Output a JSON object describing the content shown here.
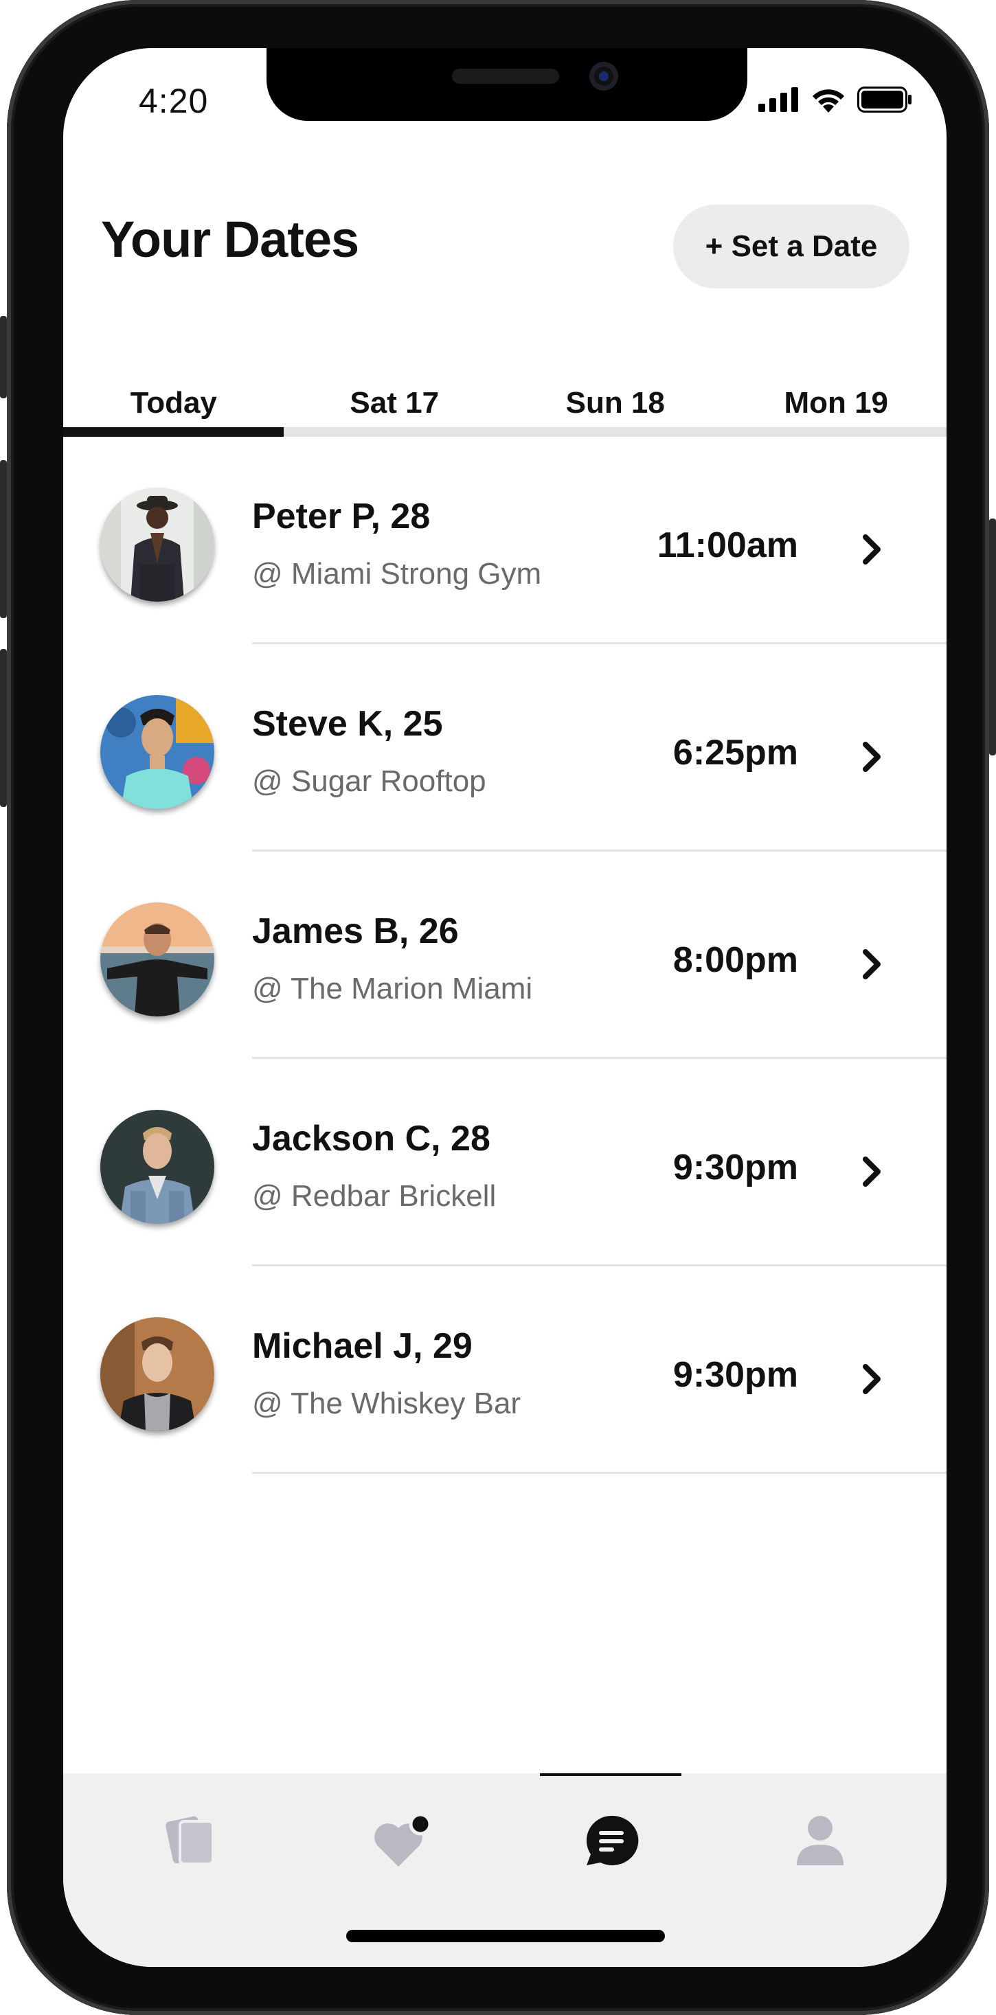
{
  "status_bar": {
    "time": "4:20"
  },
  "header": {
    "title": "Your Dates",
    "set_date_label": "+ Set a Date"
  },
  "tabs": [
    {
      "label": "Today"
    },
    {
      "label": "Sat 17"
    },
    {
      "label": "Sun 18"
    },
    {
      "label": "Mon 19"
    }
  ],
  "dates": [
    {
      "name": "Peter P, 28",
      "venue": "@ Miami Strong Gym",
      "time": "11:00am"
    },
    {
      "name": "Steve K, 25",
      "venue": "@ Sugar Rooftop",
      "time": "6:25pm"
    },
    {
      "name": "James B, 26",
      "venue": "@ The Marion Miami",
      "time": "8:00pm"
    },
    {
      "name": "Jackson C, 28",
      "venue": "@ Redbar Brickell",
      "time": "9:30pm"
    },
    {
      "name": "Michael J, 29",
      "venue": "@ The Whiskey Bar",
      "time": "9:30pm"
    }
  ],
  "bottom_nav": [
    {
      "icon": "cards-icon",
      "active": false
    },
    {
      "icon": "heart-notification-icon",
      "active": false
    },
    {
      "icon": "chat-bubble-icon",
      "active": true
    },
    {
      "icon": "profile-icon",
      "active": false
    }
  ],
  "colors": {
    "text": "#111111",
    "secondary_text": "#6a6a6a",
    "inactive_icon": "#b9b9c4",
    "button_bg": "#ececec"
  }
}
